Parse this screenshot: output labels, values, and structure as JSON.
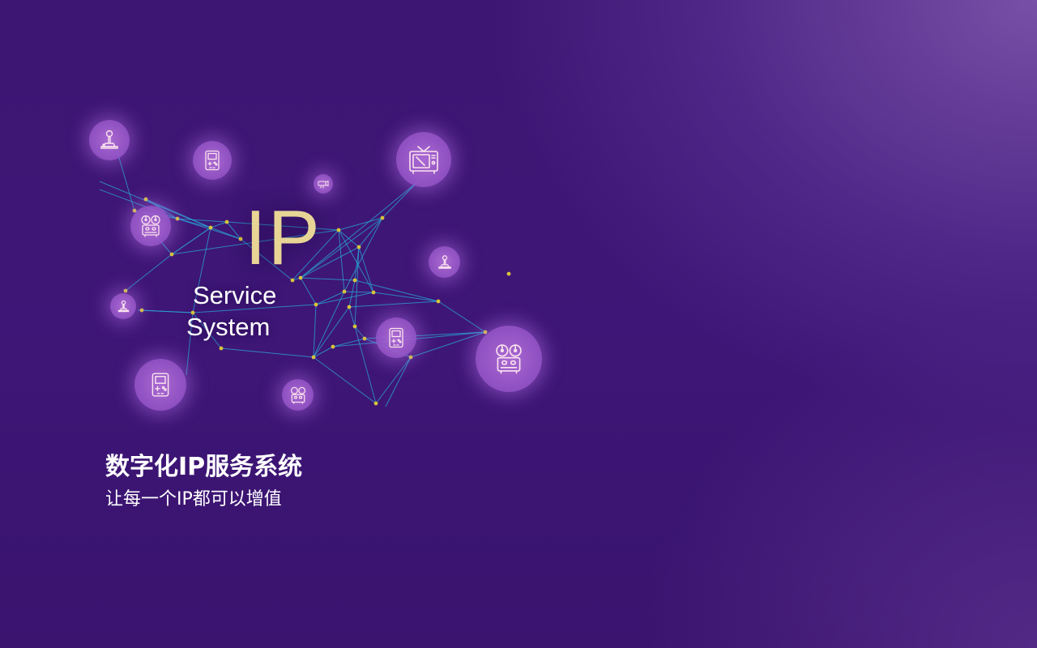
{
  "hero": {
    "ip_label": "IP",
    "service_label": "Service",
    "system_label": "System"
  },
  "headline": {
    "title": "数字化IP服务系统",
    "subtitle": "让每一个IP都可以增值"
  },
  "icons": [
    "joystick-icon",
    "handheld-console-icon",
    "projector-icon",
    "retro-tv-icon",
    "film-projector-icon",
    "joystick-icon",
    "joystick-icon",
    "handheld-console-icon",
    "film-projector-icon",
    "handheld-console-icon",
    "film-projector-icon"
  ],
  "colors": {
    "background": "#3e1677",
    "accent_gold": "#e8d596",
    "network_line": "#2aa8d8",
    "network_node": "#d8c43a",
    "bubble": "#9a5ac8"
  }
}
